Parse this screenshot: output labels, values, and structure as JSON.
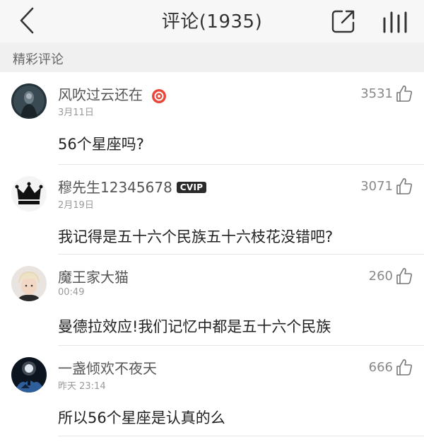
{
  "header": {
    "title": "评论(1935)",
    "back_icon": "chevron-left-icon",
    "share_icon": "share-icon",
    "menu_icon": "vertical-bars-icon"
  },
  "section": {
    "title": "精彩评论"
  },
  "comments": [
    {
      "username": "风吹过云还在",
      "badge": "red-badge-icon",
      "time": "3月11日",
      "likes": "3531",
      "text": "56个星座吗?"
    },
    {
      "username": "穆先生12345678",
      "badge_text": "CVIP",
      "time": "2月19日",
      "likes": "3071",
      "text": "我记得是五十六个民族五十六枝花没错吧?"
    },
    {
      "username": "魔王家大猫",
      "time": "00:49",
      "likes": "260",
      "text": "曼德拉效应!我们记忆中都是五十六个民族"
    },
    {
      "username": "一盏倾欢不夜天",
      "time": "昨天 23:14",
      "likes": "666",
      "text": "所以56个星座是认真的么"
    }
  ]
}
